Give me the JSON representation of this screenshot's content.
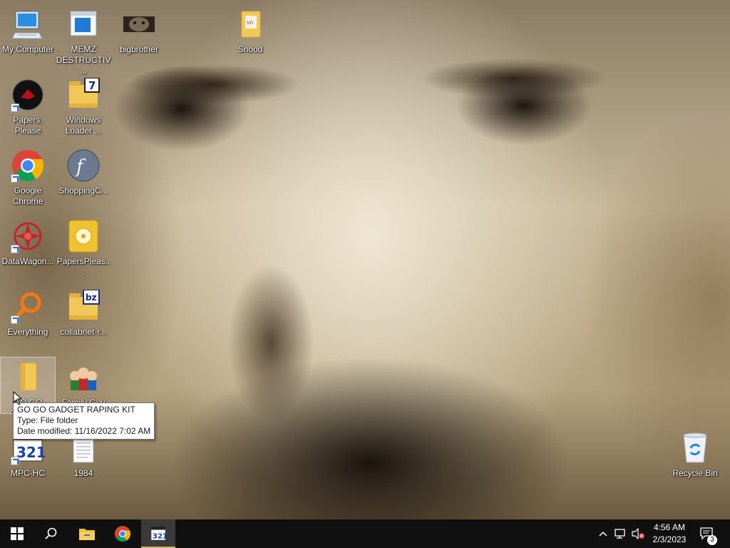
{
  "desktop": {
    "icons": [
      {
        "label": "My Computer"
      },
      {
        "label": "MEMZ DESTRUCTIV..."
      },
      {
        "label": "bigbrother"
      },
      {
        "label": "Snood"
      },
      {
        "label": "Papers, Please"
      },
      {
        "label": "Windows Loader ..."
      },
      {
        "label": "Google Chrome"
      },
      {
        "label": "ShoppingC..."
      },
      {
        "label": "DataWagon..."
      },
      {
        "label": "PapersPleas..."
      },
      {
        "label": "Everything"
      },
      {
        "label": "collabnet-r..."
      },
      {
        "label": "GO GO GADGET RAPING KIT"
      },
      {
        "label": "Family Guy"
      },
      {
        "label": "MPC-HC"
      },
      {
        "label": "1984"
      },
      {
        "label": "Recycle Bin"
      }
    ],
    "tooltip": {
      "name": "GO GO GADGET RAPING KIT",
      "type": "Type: File folder",
      "modified": "Date modified: 11/16/2022 7:02 AM"
    }
  },
  "taskbar": {
    "clock": {
      "time": "4:56 AM",
      "date": "2/3/2023"
    },
    "notification_count": "3"
  }
}
